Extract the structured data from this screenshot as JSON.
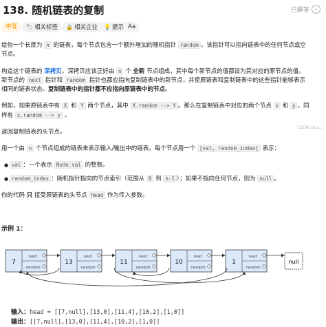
{
  "header": {
    "title": "138. 随机链表的复制",
    "status": "已解答",
    "status_icon": "check-circle-icon"
  },
  "tags": {
    "difficulty": "中等",
    "topics": "相关标签",
    "companies": "相关企业",
    "hint": "提示",
    "font": "Aa"
  },
  "desc": {
    "p1_a": "给你一个长度为",
    "p1_n": "n",
    "p1_b": "的链表，每个节点包含一个额外增加的随机指针",
    "p1_random": "random",
    "p1_c": "，该指针可以指向链表中的任何节点或空",
    "p1_d": "节点。",
    "p2_a": "构造这个链表的",
    "p2_link": "深拷贝",
    "p2_b": "。深拷贝应该正好由",
    "p2_n": "n",
    "p2_c": "个",
    "p2_new": "全新",
    "p2_d": "节点组成，其中每个新节点的值都设为其对应的原节点的值。",
    "p2_e": "新节点的",
    "p2_next": "next",
    "p2_f": "指针和",
    "p2_random": "random",
    "p2_g": "指针也都应指向复制链表中的新节点，并使原链表和复制链表中的这些指针能够表示",
    "p2_h": "相同的链表状态。",
    "p2_bold": "复制链表中的指针都不应指向原链表中的节点",
    "p2_i": "。",
    "p3_a": "例如，如果原链表中有",
    "p3_X": "X",
    "p3_b": "和",
    "p3_Y": "Y",
    "p3_c": "两个节点，其中",
    "p3_expr": "X.random --> Y",
    "p3_d": "。那么在复制链表中对应的两个节点",
    "p3_x": "x",
    "p3_e": "和",
    "p3_y": "y",
    "p3_f": "，同",
    "p3_g": "样有",
    "p3_expr2": "x.random --> y",
    "p3_h": "。",
    "p4": "返回复制链表的头节点。",
    "p5_a": "用一个由",
    "p5_n": "n",
    "p5_b": "个节点组成的链表来表示输入/输出中的链表。每个节点用一个",
    "p5_pair": "[val, random_index]",
    "p5_c": "表示：",
    "li1_code": "val",
    "li1_text": "：一个表示",
    "li1_code2": "Node.val",
    "li1_text2": "的整数。",
    "li2_code": "random_index",
    "li2_text": "：随机指针指向的节点索引（范围从",
    "li2_zero": "0",
    "li2_to": "到",
    "li2_n1": "n-1",
    "li2_text2": "）；如果不指向任何节点，则为",
    "li2_null": "null",
    "li2_end": "。",
    "p6_a": "你的代码",
    "p6_only": "只",
    "p6_b": "接受原链表的头节点",
    "p6_head": "head",
    "p6_c": "作为传入参数。"
  },
  "example": {
    "title": "示例 1：",
    "nodes": [
      "7",
      "13",
      "11",
      "10",
      "1"
    ],
    "next_label": "next",
    "random_label": "random",
    "null_label": "null",
    "input_label": "输入：",
    "input_value": "head = [[7,null],[13,0],[11,4],[10,2],[1,0]]",
    "output_label": "输出：",
    "output_value": "[[7,null],[13,0],[11,4],[10,2],[1,0]]"
  },
  "watermark": "CSDN @Lu..."
}
